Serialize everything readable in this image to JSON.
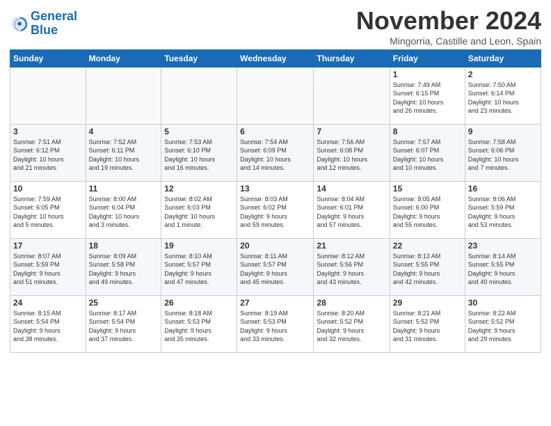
{
  "header": {
    "logo_line1": "General",
    "logo_line2": "Blue",
    "month": "November 2024",
    "location": "Mingorria, Castille and Leon, Spain"
  },
  "weekdays": [
    "Sunday",
    "Monday",
    "Tuesday",
    "Wednesday",
    "Thursday",
    "Friday",
    "Saturday"
  ],
  "weeks": [
    [
      {
        "day": "",
        "info": ""
      },
      {
        "day": "",
        "info": ""
      },
      {
        "day": "",
        "info": ""
      },
      {
        "day": "",
        "info": ""
      },
      {
        "day": "",
        "info": ""
      },
      {
        "day": "1",
        "info": "Sunrise: 7:49 AM\nSunset: 6:15 PM\nDaylight: 10 hours\nand 26 minutes."
      },
      {
        "day": "2",
        "info": "Sunrise: 7:50 AM\nSunset: 6:14 PM\nDaylight: 10 hours\nand 23 minutes."
      }
    ],
    [
      {
        "day": "3",
        "info": "Sunrise: 7:51 AM\nSunset: 6:12 PM\nDaylight: 10 hours\nand 21 minutes."
      },
      {
        "day": "4",
        "info": "Sunrise: 7:52 AM\nSunset: 6:11 PM\nDaylight: 10 hours\nand 19 minutes."
      },
      {
        "day": "5",
        "info": "Sunrise: 7:53 AM\nSunset: 6:10 PM\nDaylight: 10 hours\nand 16 minutes."
      },
      {
        "day": "6",
        "info": "Sunrise: 7:54 AM\nSunset: 6:09 PM\nDaylight: 10 hours\nand 14 minutes."
      },
      {
        "day": "7",
        "info": "Sunrise: 7:56 AM\nSunset: 6:08 PM\nDaylight: 10 hours\nand 12 minutes."
      },
      {
        "day": "8",
        "info": "Sunrise: 7:57 AM\nSunset: 6:07 PM\nDaylight: 10 hours\nand 10 minutes."
      },
      {
        "day": "9",
        "info": "Sunrise: 7:58 AM\nSunset: 6:06 PM\nDaylight: 10 hours\nand 7 minutes."
      }
    ],
    [
      {
        "day": "10",
        "info": "Sunrise: 7:59 AM\nSunset: 6:05 PM\nDaylight: 10 hours\nand 5 minutes."
      },
      {
        "day": "11",
        "info": "Sunrise: 8:00 AM\nSunset: 6:04 PM\nDaylight: 10 hours\nand 3 minutes."
      },
      {
        "day": "12",
        "info": "Sunrise: 8:02 AM\nSunset: 6:03 PM\nDaylight: 10 hours\nand 1 minute."
      },
      {
        "day": "13",
        "info": "Sunrise: 8:03 AM\nSunset: 6:02 PM\nDaylight: 9 hours\nand 59 minutes."
      },
      {
        "day": "14",
        "info": "Sunrise: 8:04 AM\nSunset: 6:01 PM\nDaylight: 9 hours\nand 57 minutes."
      },
      {
        "day": "15",
        "info": "Sunrise: 8:05 AM\nSunset: 6:00 PM\nDaylight: 9 hours\nand 55 minutes."
      },
      {
        "day": "16",
        "info": "Sunrise: 8:06 AM\nSunset: 5:59 PM\nDaylight: 9 hours\nand 53 minutes."
      }
    ],
    [
      {
        "day": "17",
        "info": "Sunrise: 8:07 AM\nSunset: 5:59 PM\nDaylight: 9 hours\nand 51 minutes."
      },
      {
        "day": "18",
        "info": "Sunrise: 8:09 AM\nSunset: 5:58 PM\nDaylight: 9 hours\nand 49 minutes."
      },
      {
        "day": "19",
        "info": "Sunrise: 8:10 AM\nSunset: 5:57 PM\nDaylight: 9 hours\nand 47 minutes."
      },
      {
        "day": "20",
        "info": "Sunrise: 8:11 AM\nSunset: 5:57 PM\nDaylight: 9 hours\nand 45 minutes."
      },
      {
        "day": "21",
        "info": "Sunrise: 8:12 AM\nSunset: 5:56 PM\nDaylight: 9 hours\nand 43 minutes."
      },
      {
        "day": "22",
        "info": "Sunrise: 8:13 AM\nSunset: 5:55 PM\nDaylight: 9 hours\nand 42 minutes."
      },
      {
        "day": "23",
        "info": "Sunrise: 8:14 AM\nSunset: 5:55 PM\nDaylight: 9 hours\nand 40 minutes."
      }
    ],
    [
      {
        "day": "24",
        "info": "Sunrise: 8:15 AM\nSunset: 5:54 PM\nDaylight: 9 hours\nand 38 minutes."
      },
      {
        "day": "25",
        "info": "Sunrise: 8:17 AM\nSunset: 5:54 PM\nDaylight: 9 hours\nand 37 minutes."
      },
      {
        "day": "26",
        "info": "Sunrise: 8:18 AM\nSunset: 5:53 PM\nDaylight: 9 hours\nand 35 minutes."
      },
      {
        "day": "27",
        "info": "Sunrise: 8:19 AM\nSunset: 5:53 PM\nDaylight: 9 hours\nand 33 minutes."
      },
      {
        "day": "28",
        "info": "Sunrise: 8:20 AM\nSunset: 5:52 PM\nDaylight: 9 hours\nand 32 minutes."
      },
      {
        "day": "29",
        "info": "Sunrise: 8:21 AM\nSunset: 5:52 PM\nDaylight: 9 hours\nand 31 minutes."
      },
      {
        "day": "30",
        "info": "Sunrise: 8:22 AM\nSunset: 5:52 PM\nDaylight: 9 hours\nand 29 minutes."
      }
    ]
  ]
}
